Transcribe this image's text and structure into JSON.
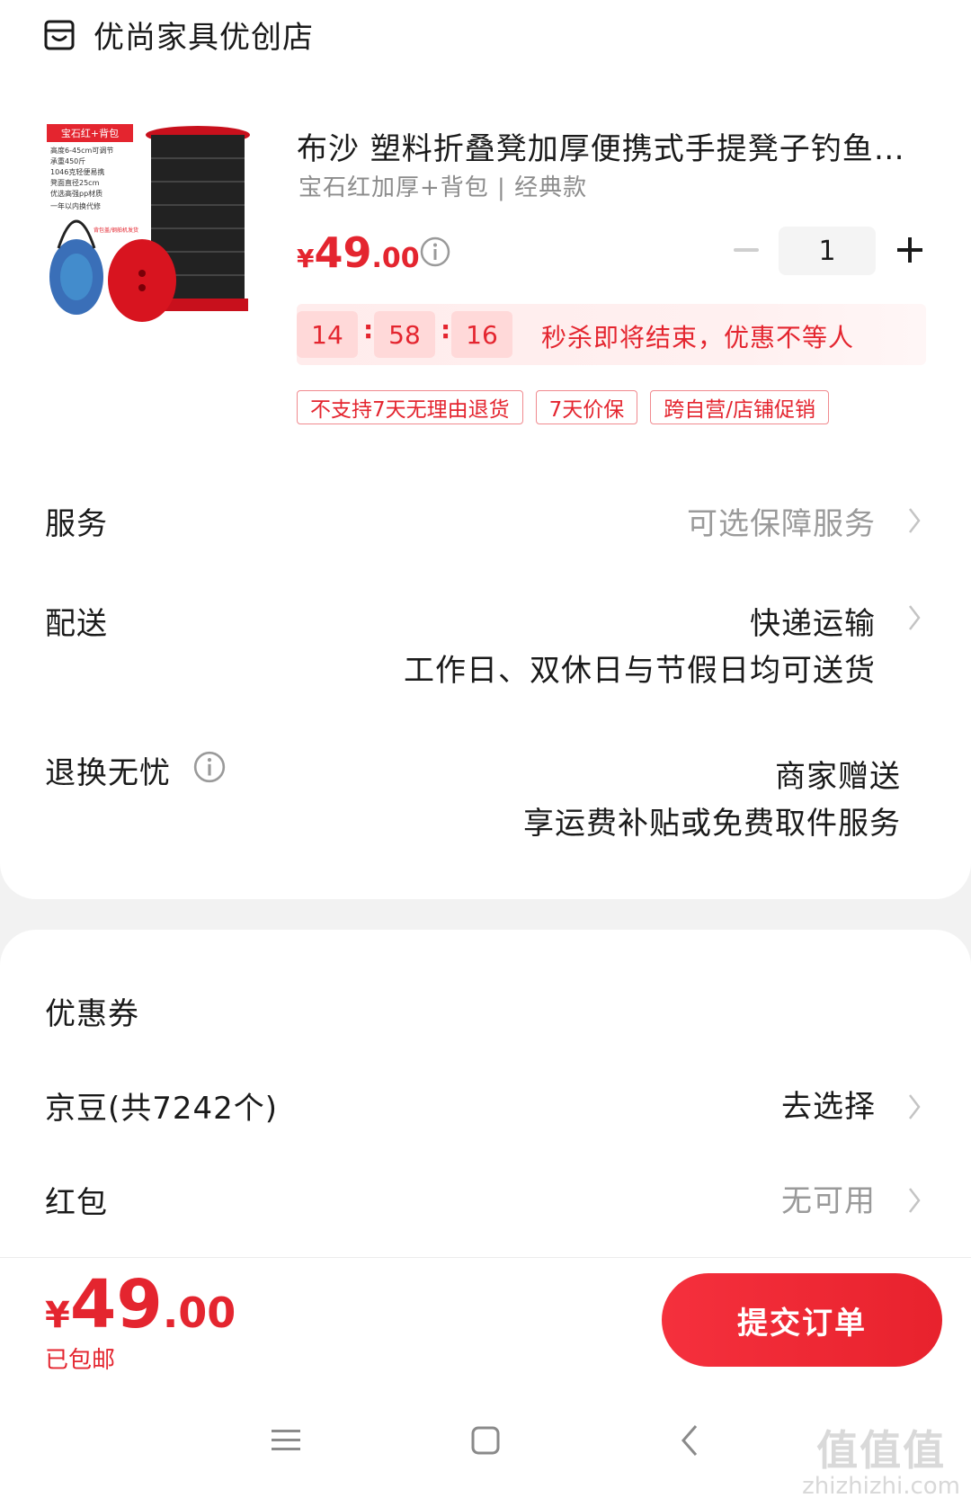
{
  "shop": {
    "name": "优尚家具优创店",
    "icon": "store-icon"
  },
  "product": {
    "title": "布沙 塑料折叠凳加厚便携式手提凳子钓鱼…",
    "spec": "宝石红加厚+背包 | 经典款",
    "price_symbol": "¥",
    "price_int": "49",
    "price_dec": ".00",
    "quantity": "1",
    "image_label_title": "宝石红+背包",
    "image_label_lines": [
      "高度6-45cm可调节",
      "承重450斤",
      "1046克轻便易携",
      "凳面直径25cm",
      "优选高强pp材质",
      "一年以内换代修"
    ],
    "image_small": "背包盖/钢舶机发货"
  },
  "flash_sale": {
    "hours": "14",
    "minutes": "58",
    "seconds": "16",
    "colon": ":",
    "text": "秒杀即将结束，优惠不等人"
  },
  "tags": [
    "不支持7天无理由退货",
    "7天价保",
    "跨自营/店铺促销"
  ],
  "rows": {
    "service": {
      "label": "服务",
      "value": "可选保障服务"
    },
    "delivery": {
      "label": "配送",
      "value": "快递运输",
      "sub": "工作日、双休日与节假日均可送货"
    },
    "returns": {
      "label": "退换无忧",
      "value": "商家赠送",
      "sub": "享运费补贴或免费取件服务"
    },
    "coupon": {
      "label": "优惠券"
    },
    "jingdou": {
      "label": "京豆(共7242个)",
      "value": "去选择"
    },
    "redpacket": {
      "label": "红包",
      "value": "无可用"
    }
  },
  "footer": {
    "total_symbol": "¥",
    "total_int": "49",
    "total_dec": ".00",
    "shipping": "已包邮",
    "submit": "提交订单"
  },
  "watermark": {
    "big": "值值值",
    "small": "zhizhizhi.com"
  },
  "colors": {
    "accent": "#e4252f",
    "button": "#f5303d",
    "grey_text": "#9a9a9a"
  }
}
